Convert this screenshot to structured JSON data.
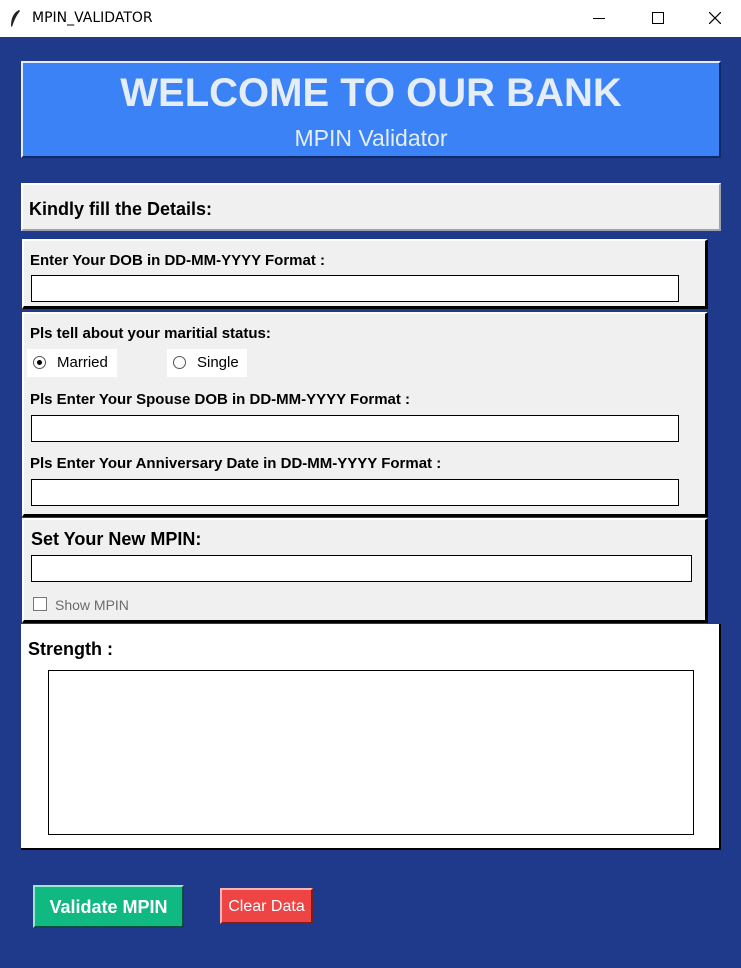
{
  "window": {
    "title": "MPIN_VALIDATOR",
    "icon": "feather-icon"
  },
  "header": {
    "title": "WELCOME TO OUR BANK",
    "subtitle": "MPIN Validator"
  },
  "instructions": "Kindly fill the Details:",
  "dob_section": {
    "label": "Enter Your DOB in DD-MM-YYYY Format :",
    "value": ""
  },
  "marital_section": {
    "label": "Pls tell about your maritial status:",
    "options": [
      {
        "label": "Married",
        "selected": true
      },
      {
        "label": "Single",
        "selected": false
      }
    ],
    "spouse_dob_label": "Pls Enter Your Spouse DOB in DD-MM-YYYY Format :",
    "spouse_dob_value": "",
    "anniversary_label": "Pls Enter Your Anniversary Date in DD-MM-YYYY Format :",
    "anniversary_value": ""
  },
  "mpin_section": {
    "label": "Set Your New MPIN:",
    "value": "",
    "show_mpin_label": "Show MPIN",
    "show_mpin_checked": false
  },
  "strength_section": {
    "label": "Strength :",
    "output": ""
  },
  "buttons": {
    "validate": "Validate MPIN",
    "clear": "Clear Data"
  },
  "colors": {
    "background": "#1f3a8a",
    "header_bg": "#3b82f6",
    "validate_bg": "#10b981",
    "clear_bg": "#ef4444"
  }
}
